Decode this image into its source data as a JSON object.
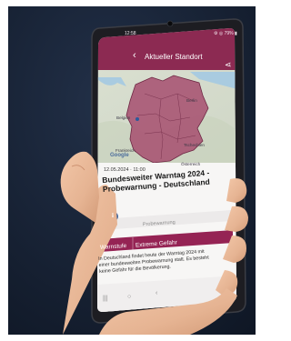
{
  "status_bar": {
    "time": "12:58",
    "right": "⚙ ◎ 79% ▮"
  },
  "header": {
    "title": "Aktueller Standort"
  },
  "map": {
    "labels": {
      "belgien": "Belgien",
      "frankreich": "Frankreich",
      "tschechien": "Tschechien",
      "oesterreich": "Österreich",
      "berlin": "Berlin"
    },
    "attribution": "Google"
  },
  "alert": {
    "date": "12.05.2024  ·  11:00",
    "headline": "Bundesweiter Warntag 2024 - Probewarnung - Deutschland",
    "warning_type_label": "Probewarnung",
    "level_label": "Warnstufe",
    "level_value": "Extreme Gefahr",
    "body": "In Deutschland findet heute der Warntag 2024 mit einer bundesweiten Probewarnung statt. Es besteht keine Gefahr für die Bevölkerung."
  },
  "colors": {
    "header": "#8c2a52",
    "warning_region": "#a64d6f",
    "level_bar": "#952354",
    "info_icon": "#2c5a9a",
    "background": "#162031",
    "skin": "#e9bb9c"
  }
}
